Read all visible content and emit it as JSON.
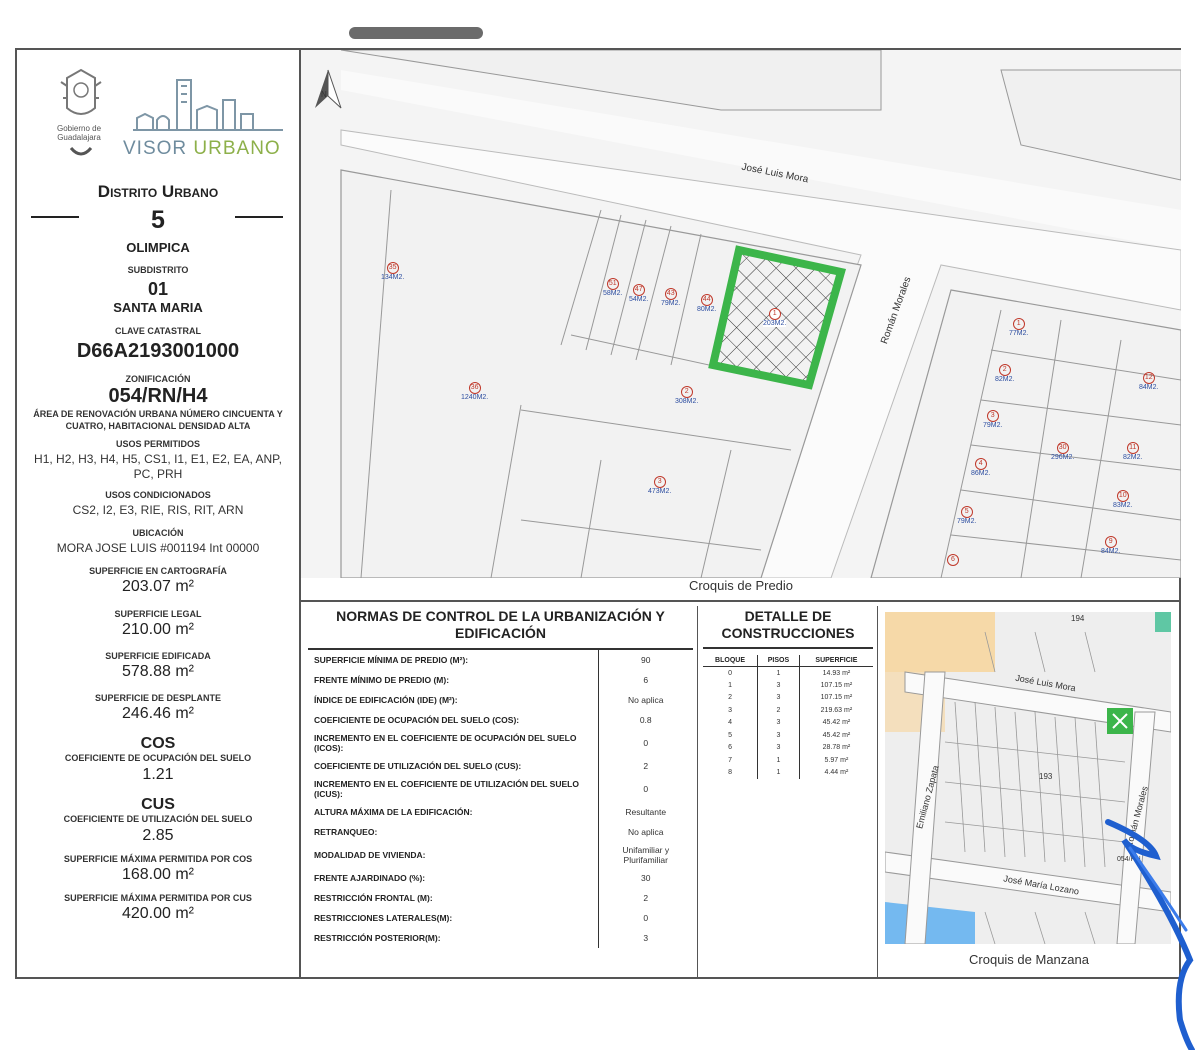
{
  "header": {
    "gov_text": "Gobierno de Guadalajara",
    "brand_part1": "VISOR ",
    "brand_part2": "URBANO"
  },
  "sidebar": {
    "distrito_label": "Distrito Urbano",
    "distrito_num": "5",
    "distrito_name": "OLIMPICA",
    "subdistrito_label": "SUBDISTRITO",
    "subdistrito_num": "01",
    "subdistrito_name": "SANTA MARIA",
    "clave_label": "CLAVE CATASTRAL",
    "clave_value": "D66A2193001000",
    "zonificacion_label": "ZONIFICACIÓN",
    "zonificacion_value": "054/RN/H4",
    "zonificacion_desc": "ÁREA DE RENOVACIÓN URBANA NÚMERO CINCUENTA Y CUATRO, HABITACIONAL DENSIDAD ALTA",
    "usos_perm_label": "USOS PERMITIDOS",
    "usos_perm_value": "H1, H2, H3, H4, H5, CS1, I1, E1, E2, EA, ANP, PC, PRH",
    "usos_cond_label": "USOS CONDICIONADOS",
    "usos_cond_value": "CS2, I2, E3, RIE, RIS, RIT, ARN",
    "ubicacion_label": "UBICACIÓN",
    "ubicacion_value": "MORA JOSE LUIS #001194 Int 00000",
    "sup_cart_label": "SUPERFICIE EN CARTOGRAFÍA",
    "sup_cart_value": "203.07 m²",
    "sup_legal_label": "SUPERFICIE LEGAL",
    "sup_legal_value": "210.00 m²",
    "sup_edif_label": "SUPERFICIE EDIFICADA",
    "sup_edif_value": "578.88 m²",
    "sup_desp_label": "SUPERFICIE DE DESPLANTE",
    "sup_desp_value": "246.46 m²",
    "cos_head": "COS",
    "cos_label": "COEFICIENTE DE OCUPACIÓN DEL SUELO",
    "cos_value": "1.21",
    "cus_head": "CUS",
    "cus_label": "COEFICIENTE DE UTILIZACIÓN DEL SUELO",
    "cus_value": "2.85",
    "sup_max_cos_label": "SUPERFICIE MÁXIMA PERMITIDA POR COS",
    "sup_max_cos_value": "168.00 m²",
    "sup_max_cus_label": "SUPERFICIE MÁXIMA PERMITIDA POR CUS",
    "sup_max_cus_value": "420.00 m²"
  },
  "map": {
    "north": "N",
    "street_top": "José Luis Mora",
    "street_right": "Román Morales",
    "caption": "Croquis de Predio",
    "lots": [
      {
        "num": "35",
        "area": "134M2."
      },
      {
        "num": "51",
        "area": "58M2."
      },
      {
        "num": "47",
        "area": "54M2."
      },
      {
        "num": "43",
        "area": "79M2."
      },
      {
        "num": "44",
        "area": "80M2."
      },
      {
        "num": "1",
        "area": "203M2."
      },
      {
        "num": "36",
        "area": "1240M2."
      },
      {
        "num": "2",
        "area": "308M2."
      },
      {
        "num": "3",
        "area": "473M2."
      },
      {
        "num": "1",
        "area": "77M2."
      },
      {
        "num": "2",
        "area": "82M2."
      },
      {
        "num": "3",
        "area": "79M2."
      },
      {
        "num": "4",
        "area": "86M2."
      },
      {
        "num": "5",
        "area": "79M2."
      },
      {
        "num": "6",
        "area": ""
      },
      {
        "num": "30",
        "area": "296M2."
      },
      {
        "num": "12",
        "area": "84M2."
      },
      {
        "num": "11",
        "area": "82M2."
      },
      {
        "num": "10",
        "area": "83M2."
      },
      {
        "num": "9",
        "area": "84M2."
      }
    ]
  },
  "normas": {
    "title": "NORMAS DE CONTROL DE LA URBANIZACIÓN Y EDIFICACIÓN",
    "rows": [
      {
        "k": "SUPERFICIE MÍNIMA DE PREDIO (m²):",
        "v": "90"
      },
      {
        "k": "FRENTE MÍNIMO DE PREDIO (m):",
        "v": "6"
      },
      {
        "k": "ÍNDICE DE EDIFICACIÓN (IDE) (m²):",
        "v": "No aplica"
      },
      {
        "k": "COEFICIENTE DE OCUPACIÓN DEL SUELO (COS):",
        "v": "0.8"
      },
      {
        "k": "INCREMENTO EN EL COEFICIENTE DE OCUPACIÓN DEL SUELO (ICOS):",
        "v": "0"
      },
      {
        "k": "COEFICIENTE DE UTILIZACIÓN DEL SUELO (CUS):",
        "v": "2"
      },
      {
        "k": "INCREMENTO EN EL COEFICIENTE DE UTILIZACIÓN DEL SUELO (ICUS):",
        "v": "0"
      },
      {
        "k": "ALTURA MÁXIMA DE LA EDIFICACIÓN:",
        "v": "Resultante"
      },
      {
        "k": "RETRANQUEO:",
        "v": "No aplica"
      },
      {
        "k": "MODALIDAD DE VIVIENDA:",
        "v": "Unifamiliar y Plurifamiliar"
      },
      {
        "k": "FRENTE AJARDINADO (%):",
        "v": "30"
      },
      {
        "k": "RESTRICCIÓN FRONTAL (m):",
        "v": "2"
      },
      {
        "k": "RESTRICCIONES LATERALES(m):",
        "v": "0"
      },
      {
        "k": "RESTRICCIÓN POSTERIOR(m):",
        "v": "3"
      }
    ]
  },
  "detalle": {
    "title": "DETALLE DE CONSTRUCCIONES",
    "headers": [
      "BLOQUE",
      "PISOS",
      "SUPERFICIE"
    ],
    "rows": [
      [
        "0",
        "1",
        "14.93 m²"
      ],
      [
        "1",
        "3",
        "107.15 m²"
      ],
      [
        "2",
        "3",
        "107.15 m²"
      ],
      [
        "3",
        "2",
        "219.63 m²"
      ],
      [
        "4",
        "3",
        "45.42 m²"
      ],
      [
        "5",
        "3",
        "45.42 m²"
      ],
      [
        "6",
        "3",
        "28.78 m²"
      ],
      [
        "7",
        "1",
        "5.97 m²"
      ],
      [
        "8",
        "1",
        "4.44 m²"
      ]
    ]
  },
  "manzana": {
    "caption": "Croquis de Manzana",
    "street_1": "José Luis Mora",
    "street_2": "Emiliano Zapata",
    "street_3": "Román Morales",
    "street_4": "José María Lozano",
    "block_1": "194",
    "block_2": "193",
    "zone_label": "054/RN"
  },
  "colors": {
    "highlight_green": "#3cb54a",
    "brand_green": "#8db04a",
    "brand_blue": "#6f8c9e",
    "lot_marker_red": "#c0392b",
    "lot_area_blue": "#2c4da0",
    "pen_blue": "#1f5fcf"
  }
}
